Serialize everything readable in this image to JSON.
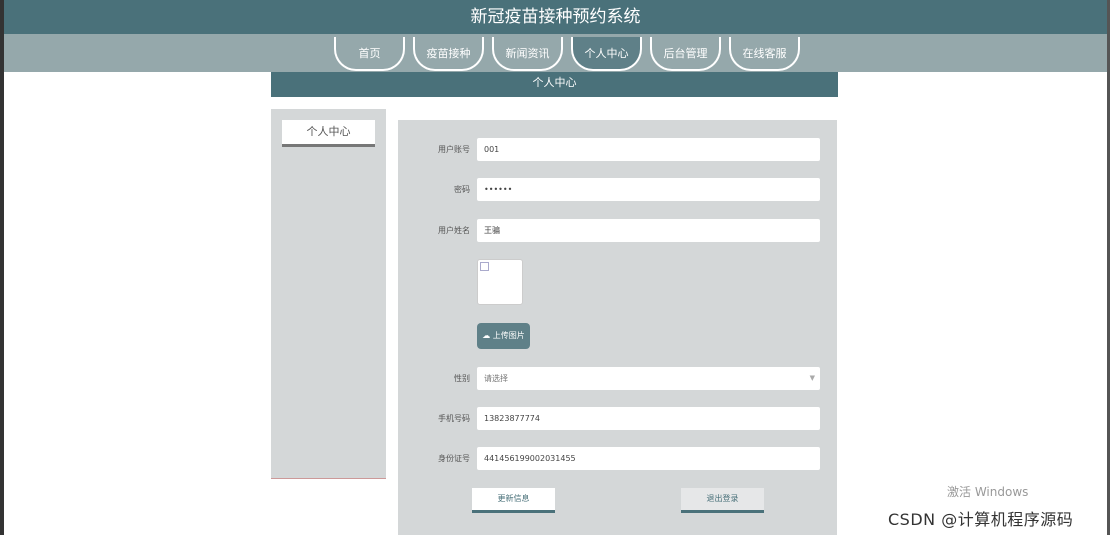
{
  "header": {
    "title": "新冠疫苗接种预约系统"
  },
  "nav": {
    "items": [
      "首页",
      "疫苗接种",
      "新闻资讯",
      "个人中心",
      "后台管理",
      "在线客服"
    ],
    "active": 3
  },
  "subbar": {
    "title": "个人中心"
  },
  "sidebar": {
    "item": "个人中心"
  },
  "form": {
    "account_label": "用户账号",
    "account": "001",
    "password_label": "密码",
    "password": "••••••",
    "name_label": "用户姓名",
    "name": "王骗",
    "upload_label": "上传图片",
    "gender_label": "性别",
    "gender_placeholder": "请选择",
    "phone_label": "手机号码",
    "phone": "13823877774",
    "id_label": "身份证号",
    "id": "441456199002031455",
    "update_btn": "更新信息",
    "logout_btn": "退出登录"
  },
  "watermark": {
    "activate": "激活 Windows",
    "csdn": "CSDN @计算机程序源码"
  },
  "colors": {
    "primary": "#4a717a",
    "nav": "#95a8ab",
    "panel": "#d4d7d8"
  }
}
